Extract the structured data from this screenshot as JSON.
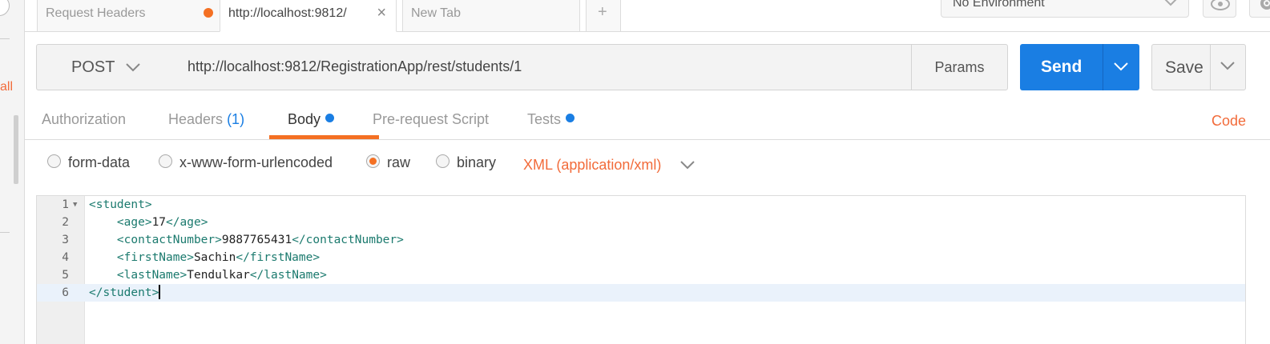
{
  "sidebar": {
    "partial_link": "all"
  },
  "tabs": [
    {
      "label": "Request Headers",
      "unsaved": true
    },
    {
      "label": "http://localhost:9812/",
      "active": true
    },
    {
      "label": "New Tab"
    }
  ],
  "environment": {
    "selected": "No Environment"
  },
  "request": {
    "method": "POST",
    "url": "http://localhost:9812/RegistrationApp/rest/students/1",
    "params_label": "Params",
    "send_label": "Send",
    "save_label": "Save"
  },
  "section_tabs": {
    "authorization": "Authorization",
    "headers": "Headers",
    "headers_count": "(1)",
    "body": "Body",
    "prerequest": "Pre-request Script",
    "tests": "Tests",
    "code": "Code"
  },
  "body_modes": {
    "form_data": "form-data",
    "urlencoded": "x-www-form-urlencoded",
    "raw": "raw",
    "binary": "binary",
    "selected": "raw",
    "content_type": "XML (application/xml)"
  },
  "editor": {
    "lines": [
      {
        "n": "1",
        "indent": "",
        "open": "<student>",
        "text": "",
        "close": ""
      },
      {
        "n": "2",
        "indent": "    ",
        "open": "<age>",
        "text": "17",
        "close": "</age>"
      },
      {
        "n": "3",
        "indent": "    ",
        "open": "<contactNumber>",
        "text": "9887765431",
        "close": "</contactNumber>"
      },
      {
        "n": "4",
        "indent": "    ",
        "open": "<firstName>",
        "text": "Sachin",
        "close": "</firstName>"
      },
      {
        "n": "5",
        "indent": "    ",
        "open": "<lastName>",
        "text": "Tendulkar",
        "close": "</lastName>"
      },
      {
        "n": "6",
        "indent": "",
        "open": "</student>",
        "text": "",
        "close": ""
      }
    ],
    "current_line": 6
  },
  "colors": {
    "accent_orange": "#f47023",
    "send_blue": "#1a7ee3",
    "xml_tag": "#1b7a6e"
  }
}
